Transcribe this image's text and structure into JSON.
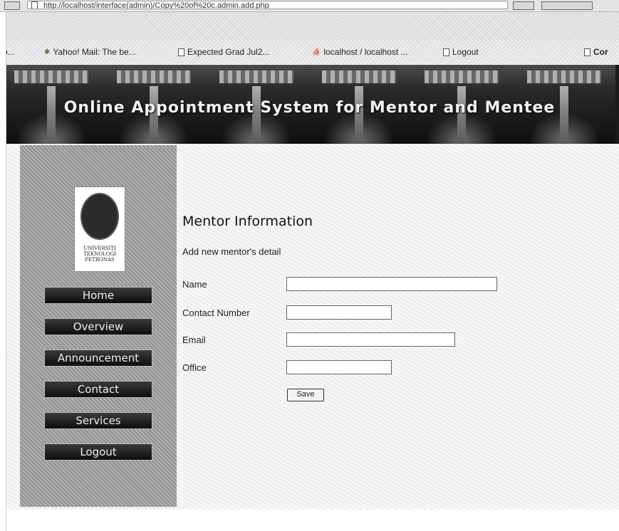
{
  "browser": {
    "address": "http://localhost/interface(admin)/Copy%20of%20c.admin.add.php",
    "bookmarks": [
      {
        "label": "Yahoo! Mail: The be..."
      },
      {
        "label": "Expected Grad Jul2..."
      },
      {
        "label": "localhost / localhost ..."
      },
      {
        "label": "Logout"
      },
      {
        "label": "Cor"
      }
    ]
  },
  "banner": {
    "title": "Online Appointment System for Mentor and Mentee"
  },
  "logo": {
    "text": "UNIVERSITI TEKNOLOGI PETRONAS"
  },
  "nav": [
    {
      "label": "Home"
    },
    {
      "label": "Overview"
    },
    {
      "label": "Announcement"
    },
    {
      "label": "Contact"
    },
    {
      "label": "Services"
    },
    {
      "label": "Logout"
    }
  ],
  "form": {
    "title": "Mentor Information",
    "subtitle": "Add new mentor's detail",
    "fields": [
      {
        "label": "Name",
        "value": ""
      },
      {
        "label": "Contact Number",
        "value": ""
      },
      {
        "label": "Email",
        "value": ""
      },
      {
        "label": "Office",
        "value": ""
      }
    ],
    "save_label": "Save"
  }
}
